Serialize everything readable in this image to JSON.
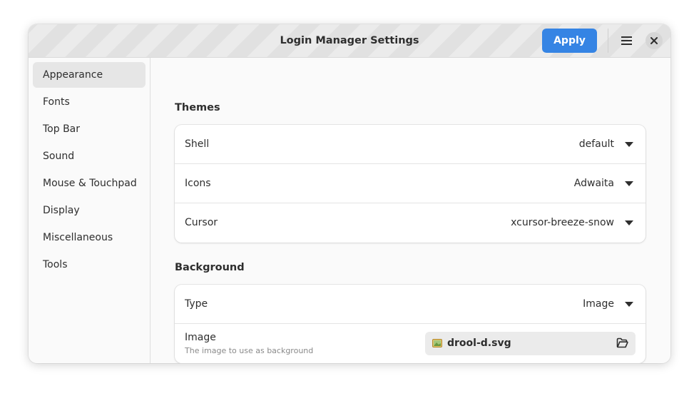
{
  "window": {
    "title": "Login Manager Settings",
    "apply_label": "Apply"
  },
  "sidebar": {
    "items": [
      {
        "label": "Appearance",
        "active": true
      },
      {
        "label": "Fonts"
      },
      {
        "label": "Top Bar"
      },
      {
        "label": "Sound"
      },
      {
        "label": "Mouse & Touchpad"
      },
      {
        "label": "Display"
      },
      {
        "label": "Miscellaneous"
      },
      {
        "label": "Tools"
      }
    ]
  },
  "themes": {
    "title": "Themes",
    "rows": [
      {
        "label": "Shell",
        "value": "default"
      },
      {
        "label": "Icons",
        "value": "Adwaita"
      },
      {
        "label": "Cursor",
        "value": "xcursor-breeze-snow"
      }
    ]
  },
  "background": {
    "title": "Background",
    "type": {
      "label": "Type",
      "value": "Image"
    },
    "image": {
      "label": "Image",
      "subtitle": "The image to use as background",
      "file_name": "drool-d.svg"
    }
  },
  "colors": {
    "accent": "#3584e4",
    "window_bg": "#fafafa",
    "card_bg": "#ffffff"
  },
  "icons": {
    "menu": "hamburger-menu-icon",
    "close": "close-icon",
    "dropdown": "chevron-down-icon",
    "file": "image-file-icon",
    "open": "folder-open-icon"
  }
}
